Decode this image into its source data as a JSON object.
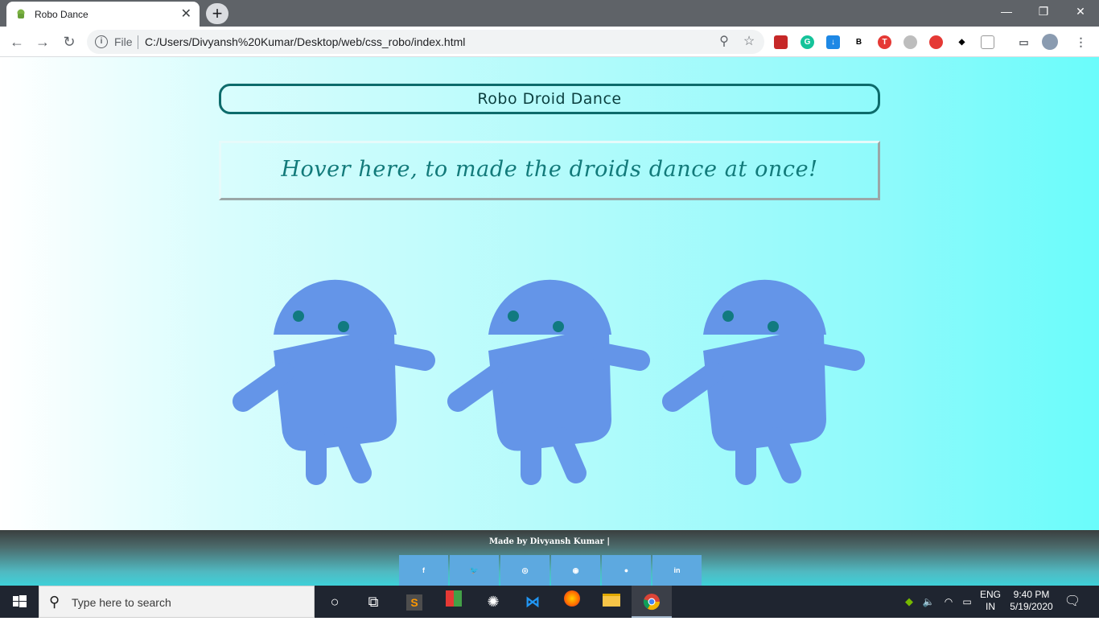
{
  "browser": {
    "tab_title": "Robo Dance",
    "tab_close": "✕",
    "new_tab": "+",
    "file_label": "File",
    "url": "C:/Users/Divyansh%20Kumar/Desktop/web/css_robo/index.html",
    "window_controls": {
      "minimize": "—",
      "restore": "❐",
      "close": "✕"
    }
  },
  "page": {
    "heading": "Robo Droid Dance",
    "hover_prompt": "Hover here, to made the droids dance at once!",
    "droid_color": "#6495e8",
    "eye_color": "#117a80"
  },
  "footer": {
    "credit": "Made by Divyansh Kumar |",
    "socials": [
      "f",
      "t",
      "ig",
      "gh",
      "web",
      "in"
    ]
  },
  "taskbar": {
    "search_placeholder": "Type here to search",
    "language": "ENG",
    "region": "IN",
    "time": "9:40 PM",
    "date": "5/19/2020"
  }
}
